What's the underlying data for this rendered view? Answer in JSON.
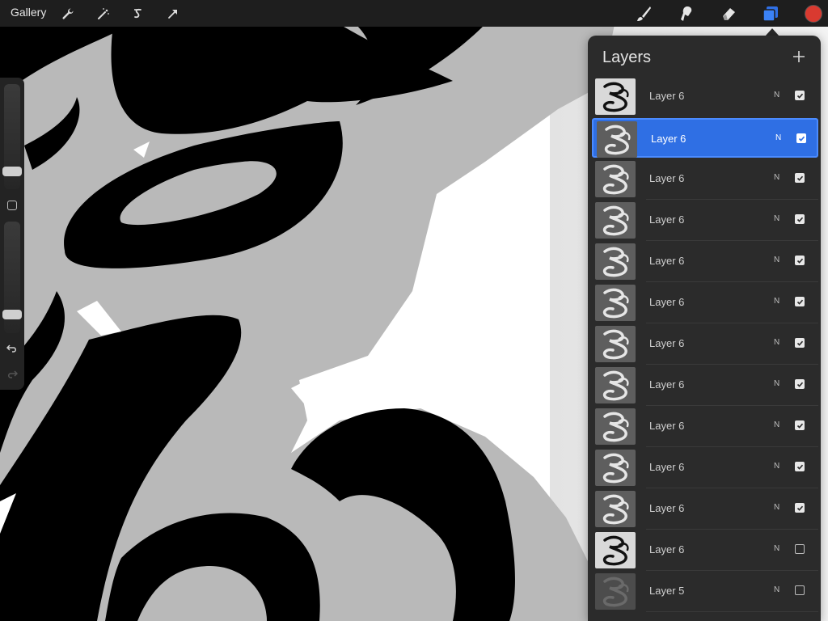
{
  "toolbar": {
    "gallery_label": "Gallery",
    "left_tools": [
      {
        "name": "actions-icon"
      },
      {
        "name": "adjustments-icon"
      },
      {
        "name": "selection-icon"
      },
      {
        "name": "transform-icon"
      }
    ],
    "right_tools": [
      {
        "name": "brush-icon"
      },
      {
        "name": "smudge-icon"
      },
      {
        "name": "eraser-icon"
      },
      {
        "name": "layers-icon",
        "active": true
      }
    ],
    "current_color": "#d93a30",
    "accent_color": "#2f6fe4"
  },
  "sidebar": {
    "brush_size_level": 0.1,
    "opacity_level": 0.1,
    "undo_icon": "undo-icon",
    "redo_icon": "redo-icon"
  },
  "layers_panel": {
    "title": "Layers",
    "add_icon": "plus-icon",
    "layers": [
      {
        "name": "Layer 6",
        "blend": "N",
        "visible": true,
        "selected": false,
        "thumb": "dark"
      },
      {
        "name": "Layer 6",
        "blend": "N",
        "visible": true,
        "selected": true,
        "thumb": "light"
      },
      {
        "name": "Layer 6",
        "blend": "N",
        "visible": true,
        "selected": false,
        "thumb": "light"
      },
      {
        "name": "Layer 6",
        "blend": "N",
        "visible": true,
        "selected": false,
        "thumb": "light"
      },
      {
        "name": "Layer 6",
        "blend": "N",
        "visible": true,
        "selected": false,
        "thumb": "light"
      },
      {
        "name": "Layer 6",
        "blend": "N",
        "visible": true,
        "selected": false,
        "thumb": "light"
      },
      {
        "name": "Layer 6",
        "blend": "N",
        "visible": true,
        "selected": false,
        "thumb": "light"
      },
      {
        "name": "Layer 6",
        "blend": "N",
        "visible": true,
        "selected": false,
        "thumb": "light"
      },
      {
        "name": "Layer 6",
        "blend": "N",
        "visible": true,
        "selected": false,
        "thumb": "light"
      },
      {
        "name": "Layer 6",
        "blend": "N",
        "visible": true,
        "selected": false,
        "thumb": "light"
      },
      {
        "name": "Layer 6",
        "blend": "N",
        "visible": true,
        "selected": false,
        "thumb": "light"
      },
      {
        "name": "Layer 6",
        "blend": "N",
        "visible": false,
        "selected": false,
        "thumb": "dark"
      },
      {
        "name": "Layer 5",
        "blend": "N",
        "visible": false,
        "selected": false,
        "thumb": "faded"
      }
    ]
  }
}
